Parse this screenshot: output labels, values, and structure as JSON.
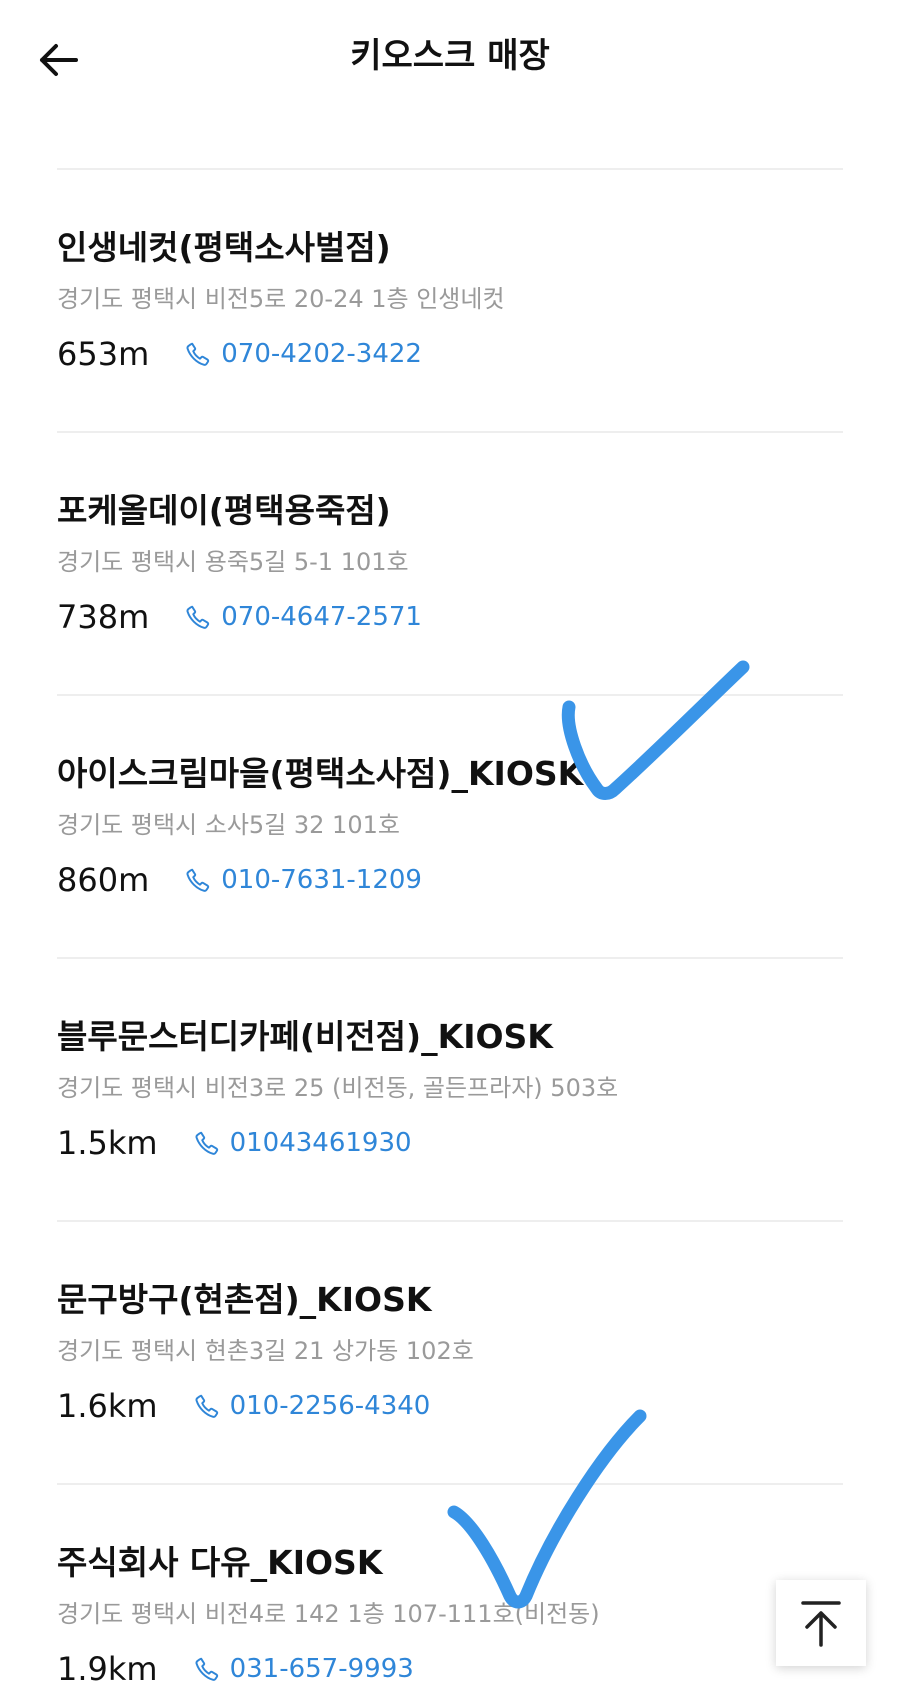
{
  "header": {
    "title": "키오스크 매장",
    "back_icon": "arrow-left-icon"
  },
  "colors": {
    "accent": "#2f86d8",
    "check_mark": "#3a95e8",
    "address": "#9a9a9a",
    "divider": "#eeeeee"
  },
  "stores": [
    {
      "name": "인생네컷(평택소사벌점)",
      "address": "경기도 평택시 비전5로 20-24 1층 인생네컷",
      "distance": "653m",
      "phone": "070-4202-3422"
    },
    {
      "name": "포케올데이(평택용죽점)",
      "address": "경기도 평택시 용죽5길 5-1 101호",
      "distance": "738m",
      "phone": "070-4647-2571"
    },
    {
      "name": "아이스크림마을(평택소사점)_KIOSK",
      "address": "경기도 평택시 소사5길 32 101호",
      "distance": "860m",
      "phone": "010-7631-1209"
    },
    {
      "name": "블루문스터디카페(비전점)_KIOSK",
      "address": "경기도 평택시 비전3로 25 (비전동, 골든프라자) 503호",
      "distance": "1.5km",
      "phone": "01043461930"
    },
    {
      "name": "문구방구(현촌점)_KIOSK",
      "address": "경기도 평택시 현촌3길 21 상가동 102호",
      "distance": "1.6km",
      "phone": "010-2256-4340"
    },
    {
      "name": "주식회사 다유_KIOSK",
      "address": "경기도 평택시 비전4로 142 1층 107-111호(비전동)",
      "distance": "1.9km",
      "phone": "031-657-9993"
    }
  ],
  "scroll_top_icon": "arrow-up-to-top-icon"
}
